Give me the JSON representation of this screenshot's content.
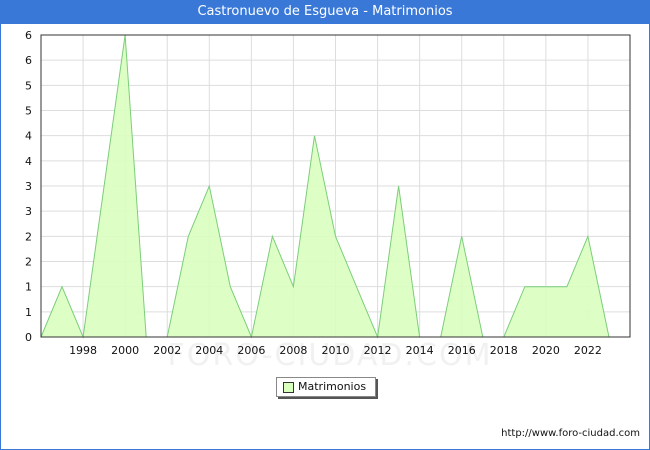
{
  "header": {
    "title": "Castronuevo de Esgueva - Matrimonios"
  },
  "footer": {
    "source": "http://www.foro-ciudad.com"
  },
  "watermark": "FORO-CIUDAD.COM",
  "colors": {
    "title_bar": "#3a78d8",
    "area_fill": "#d9ffbf",
    "line": "#7ccd7c",
    "grid": "#dddddd"
  },
  "chart_data": {
    "type": "area",
    "x": [
      1996,
      1997,
      1998,
      1999,
      2000,
      2001,
      2002,
      2003,
      2004,
      2005,
      2006,
      2007,
      2008,
      2009,
      2010,
      2011,
      2012,
      2013,
      2014,
      2015,
      2016,
      2017,
      2018,
      2019,
      2020,
      2021,
      2022,
      2023
    ],
    "series": [
      {
        "name": "Matrimonios",
        "values": [
          0,
          1,
          0,
          3,
          6,
          0,
          0,
          2,
          3,
          1,
          0,
          2,
          1,
          4,
          2,
          1,
          0,
          3,
          0,
          0,
          2,
          0,
          0,
          1,
          1,
          1,
          2,
          0
        ]
      }
    ],
    "x_ticks": [
      "1998",
      "2000",
      "2002",
      "2004",
      "2006",
      "2008",
      "2010",
      "2012",
      "2014",
      "2016",
      "2018",
      "2020",
      "2022"
    ],
    "y_ticks": [
      "0",
      "1",
      "1",
      "2",
      "2",
      "3",
      "3",
      "4",
      "4",
      "5",
      "5",
      "6",
      "6"
    ],
    "xlim": [
      1996,
      2024
    ],
    "ylim": [
      0,
      6
    ],
    "grid": true,
    "legend": "bottom-center"
  }
}
